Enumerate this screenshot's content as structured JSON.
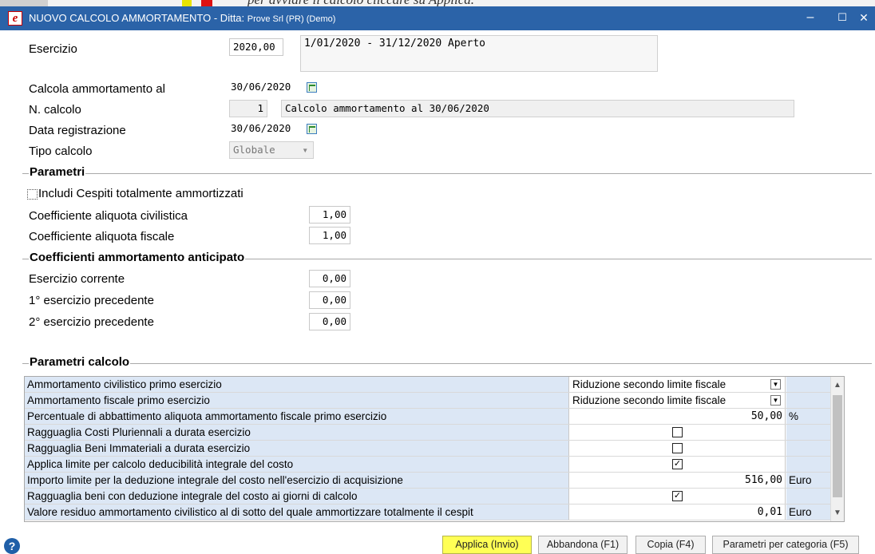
{
  "window": {
    "title": "NUOVO CALCOLO AMMORTAMENTO - Ditta: ",
    "title_company": "Prove Srl (PR) (Demo)",
    "app_icon": "e-logo-icon",
    "minimize_glyph": "–",
    "maximize_glyph": "☐",
    "close_glyph": "✕"
  },
  "behind_window_text": "per avviare il calcolo cliccare su Applica.",
  "header": {
    "esercizio_label": "Esercizio",
    "esercizio_value": "2020,00",
    "esercizio_desc": "1/01/2020 - 31/12/2020 Aperto",
    "calcola_label": "Calcola ammortamento al",
    "calcola_value": "30/06/2020",
    "ncalcolo_label": "N. calcolo",
    "ncalcolo_value": "1",
    "ncalcolo_desc": "Calcolo ammortamento al 30/06/2020",
    "data_reg_label": "Data registrazione",
    "data_reg_value": "30/06/2020",
    "tipo_label": "Tipo calcolo",
    "tipo_value": "Globale",
    "tipo_arrow": "▾"
  },
  "parametri": {
    "title": "Parametri",
    "includi_label": "Includi Cespiti totalmente ammortizzati",
    "includi_checked": false,
    "coeff_civ_label": "Coefficiente aliquota civilistica",
    "coeff_civ_value": "1,00",
    "coeff_fisc_label": "Coefficiente aliquota fiscale",
    "coeff_fisc_value": "1,00"
  },
  "anticipato": {
    "title": "Coefficienti ammortamento anticipato",
    "corrente_label": "Esercizio corrente",
    "corrente_value": "0,00",
    "prec1_label": "1° esercizio precedente",
    "prec1_value": "0,00",
    "prec2_label": "2° esercizio precedente",
    "prec2_value": "0,00"
  },
  "parametri_calcolo": {
    "title": "Parametri calcolo",
    "rows": [
      {
        "label": "Ammortamento civilistico primo esercizio",
        "value": "Riduzione secondo limite fiscale",
        "kind": "dropdown",
        "unit": ""
      },
      {
        "label": "Ammortamento fiscale primo esercizio",
        "value": "Riduzione secondo limite fiscale",
        "kind": "dropdown",
        "unit": ""
      },
      {
        "label": "Percentuale di abbattimento aliquota ammortamento fiscale primo esercizio",
        "value": "50,00",
        "kind": "number",
        "unit": "%"
      },
      {
        "label": "Ragguaglia Costi Pluriennali a durata esercizio",
        "value": "",
        "kind": "check",
        "checked": false,
        "unit": ""
      },
      {
        "label": "Ragguaglia Beni Immateriali a durata esercizio",
        "value": "",
        "kind": "check",
        "checked": false,
        "unit": ""
      },
      {
        "label": "Applica limite per calcolo deducibilità integrale del costo",
        "value": "",
        "kind": "check",
        "checked": true,
        "unit": ""
      },
      {
        "label": "Importo limite per la deduzione integrale del costo nell'esercizio di acquisizione",
        "value": "516,00",
        "kind": "number",
        "unit": "Euro"
      },
      {
        "label": "Ragguaglia beni con deduzione integrale del costo ai giorni di calcolo",
        "value": "",
        "kind": "check",
        "checked": true,
        "unit": ""
      },
      {
        "label": "Valore residuo ammortamento civilistico al di sotto del quale ammortizzare totalmente il cespit",
        "value": "0,01",
        "kind": "number",
        "unit": "Euro"
      }
    ],
    "scroll_up": "▲",
    "scroll_down": "▼"
  },
  "footer": {
    "help_glyph": "?",
    "applica": "Applica (Invio)",
    "abbandona": "Abbandona (F1)",
    "copia": "Copia (F4)",
    "parametri_cat": "Parametri per categoria (F5)"
  },
  "colors": {
    "titlebar": "#2b63a8",
    "grid_label_bg": "#dce7f5",
    "primary_button": "#ffff55"
  }
}
